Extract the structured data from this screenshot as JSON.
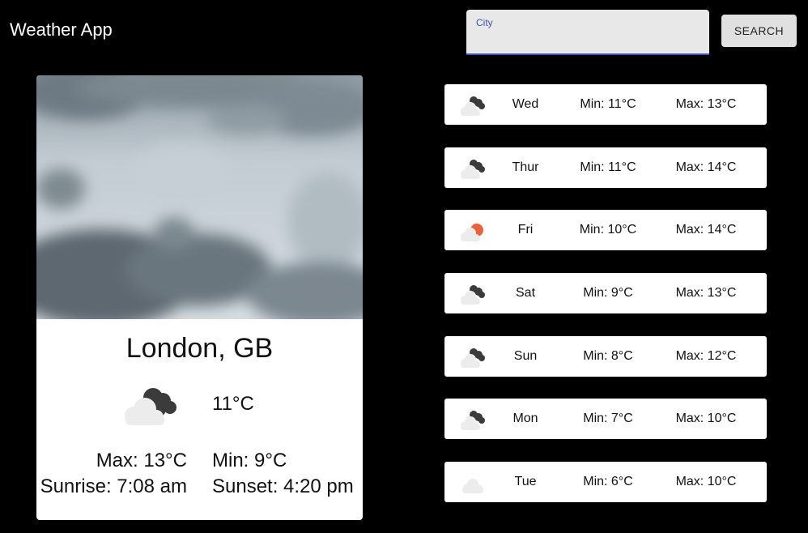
{
  "header": {
    "title": "Weather App"
  },
  "search": {
    "label": "City",
    "value": "",
    "button_label": "SEARCH"
  },
  "current": {
    "location": "London, GB",
    "temperature": "11°C",
    "max": "Max: 13°C",
    "min": "Min: 9°C",
    "sunrise": "Sunrise: 7:08 am",
    "sunset": "Sunset: 4:20 pm",
    "icon": "broken-clouds-icon",
    "image": "overcast-sky-photo"
  },
  "forecast": [
    {
      "day": "Wed",
      "min": "Min: 11°C",
      "max": "Max: 13°C",
      "icon": "broken-clouds-icon"
    },
    {
      "day": "Thur",
      "min": "Min: 11°C",
      "max": "Max: 14°C",
      "icon": "broken-clouds-icon"
    },
    {
      "day": "Fri",
      "min": "Min: 10°C",
      "max": "Max: 14°C",
      "icon": "few-clouds-sun-icon"
    },
    {
      "day": "Sat",
      "min": "Min: 9°C",
      "max": "Max: 13°C",
      "icon": "broken-clouds-icon"
    },
    {
      "day": "Sun",
      "min": "Min: 8°C",
      "max": "Max: 12°C",
      "icon": "broken-clouds-icon"
    },
    {
      "day": "Mon",
      "min": "Min: 7°C",
      "max": "Max: 10°C",
      "icon": "broken-clouds-icon"
    },
    {
      "day": "Tue",
      "min": "Min: 6°C",
      "max": "Max: 10°C",
      "icon": "light-cloud-icon"
    }
  ],
  "colors": {
    "background": "#000000",
    "accent": "#3f51b5",
    "sun": "#e8623c"
  }
}
